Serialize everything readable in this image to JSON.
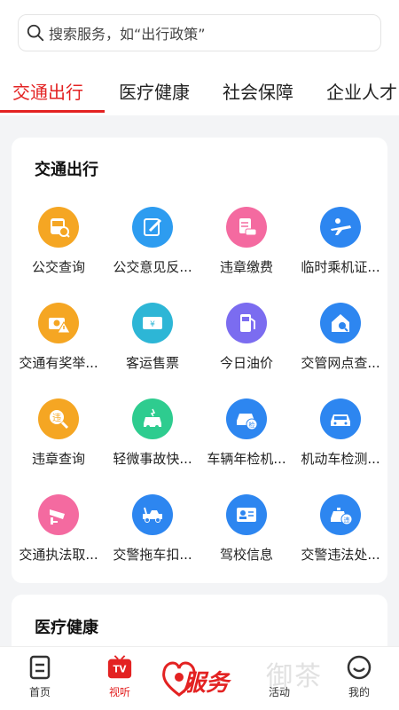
{
  "search": {
    "placeholder": "搜索服务，如“出行政策”"
  },
  "tabs": [
    {
      "label": "交通出行",
      "active": true
    },
    {
      "label": "医疗健康",
      "active": false
    },
    {
      "label": "社会保障",
      "active": false
    },
    {
      "label": "企业人才",
      "active": false
    }
  ],
  "section1": {
    "title": "交通出行",
    "services": [
      {
        "label": "公交查询",
        "icon": "bus-search-icon",
        "color": "#f5a623"
      },
      {
        "label": "公交意见反...",
        "icon": "edit-icon",
        "color": "#2d9cf0"
      },
      {
        "label": "违章缴费",
        "icon": "car-document-icon",
        "color": "#f46aa0"
      },
      {
        "label": "临时乘机证...",
        "icon": "airplane-icon",
        "color": "#2d86f0"
      },
      {
        "label": "交通有奖举...",
        "icon": "camera-warning-icon",
        "color": "#f5a623"
      },
      {
        "label": "客运售票",
        "icon": "ticket-icon",
        "color": "#2db6d6"
      },
      {
        "label": "今日油价",
        "icon": "fuel-icon",
        "color": "#7b6cf0"
      },
      {
        "label": "交管网点查...",
        "icon": "house-search-icon",
        "color": "#2d86f0"
      },
      {
        "label": "违章查询",
        "icon": "violation-search-icon",
        "color": "#f5a623"
      },
      {
        "label": "轻微事故快...",
        "icon": "car-crash-icon",
        "color": "#2ecc8f"
      },
      {
        "label": "车辆年检机...",
        "icon": "car-inspection-icon",
        "color": "#2d86f0"
      },
      {
        "label": "机动车检测...",
        "icon": "car-wrench-icon",
        "color": "#2d86f0"
      },
      {
        "label": "交通执法取...",
        "icon": "cctv-camera-icon",
        "color": "#f46aa0"
      },
      {
        "label": "交警拖车扣...",
        "icon": "tow-truck-icon",
        "color": "#2d86f0"
      },
      {
        "label": "驾校信息",
        "icon": "id-card-icon",
        "color": "#2d86f0"
      },
      {
        "label": "交警违法处...",
        "icon": "police-car-icon",
        "color": "#2d86f0"
      }
    ]
  },
  "section2": {
    "title": "医疗健康"
  },
  "bottom_nav": {
    "home": "首页",
    "video": "视听",
    "video_badge": "TV",
    "center": "服务",
    "activity": "活动",
    "mine": "我的",
    "watermark": "御茶"
  },
  "colors": {
    "accent": "#e32222"
  }
}
